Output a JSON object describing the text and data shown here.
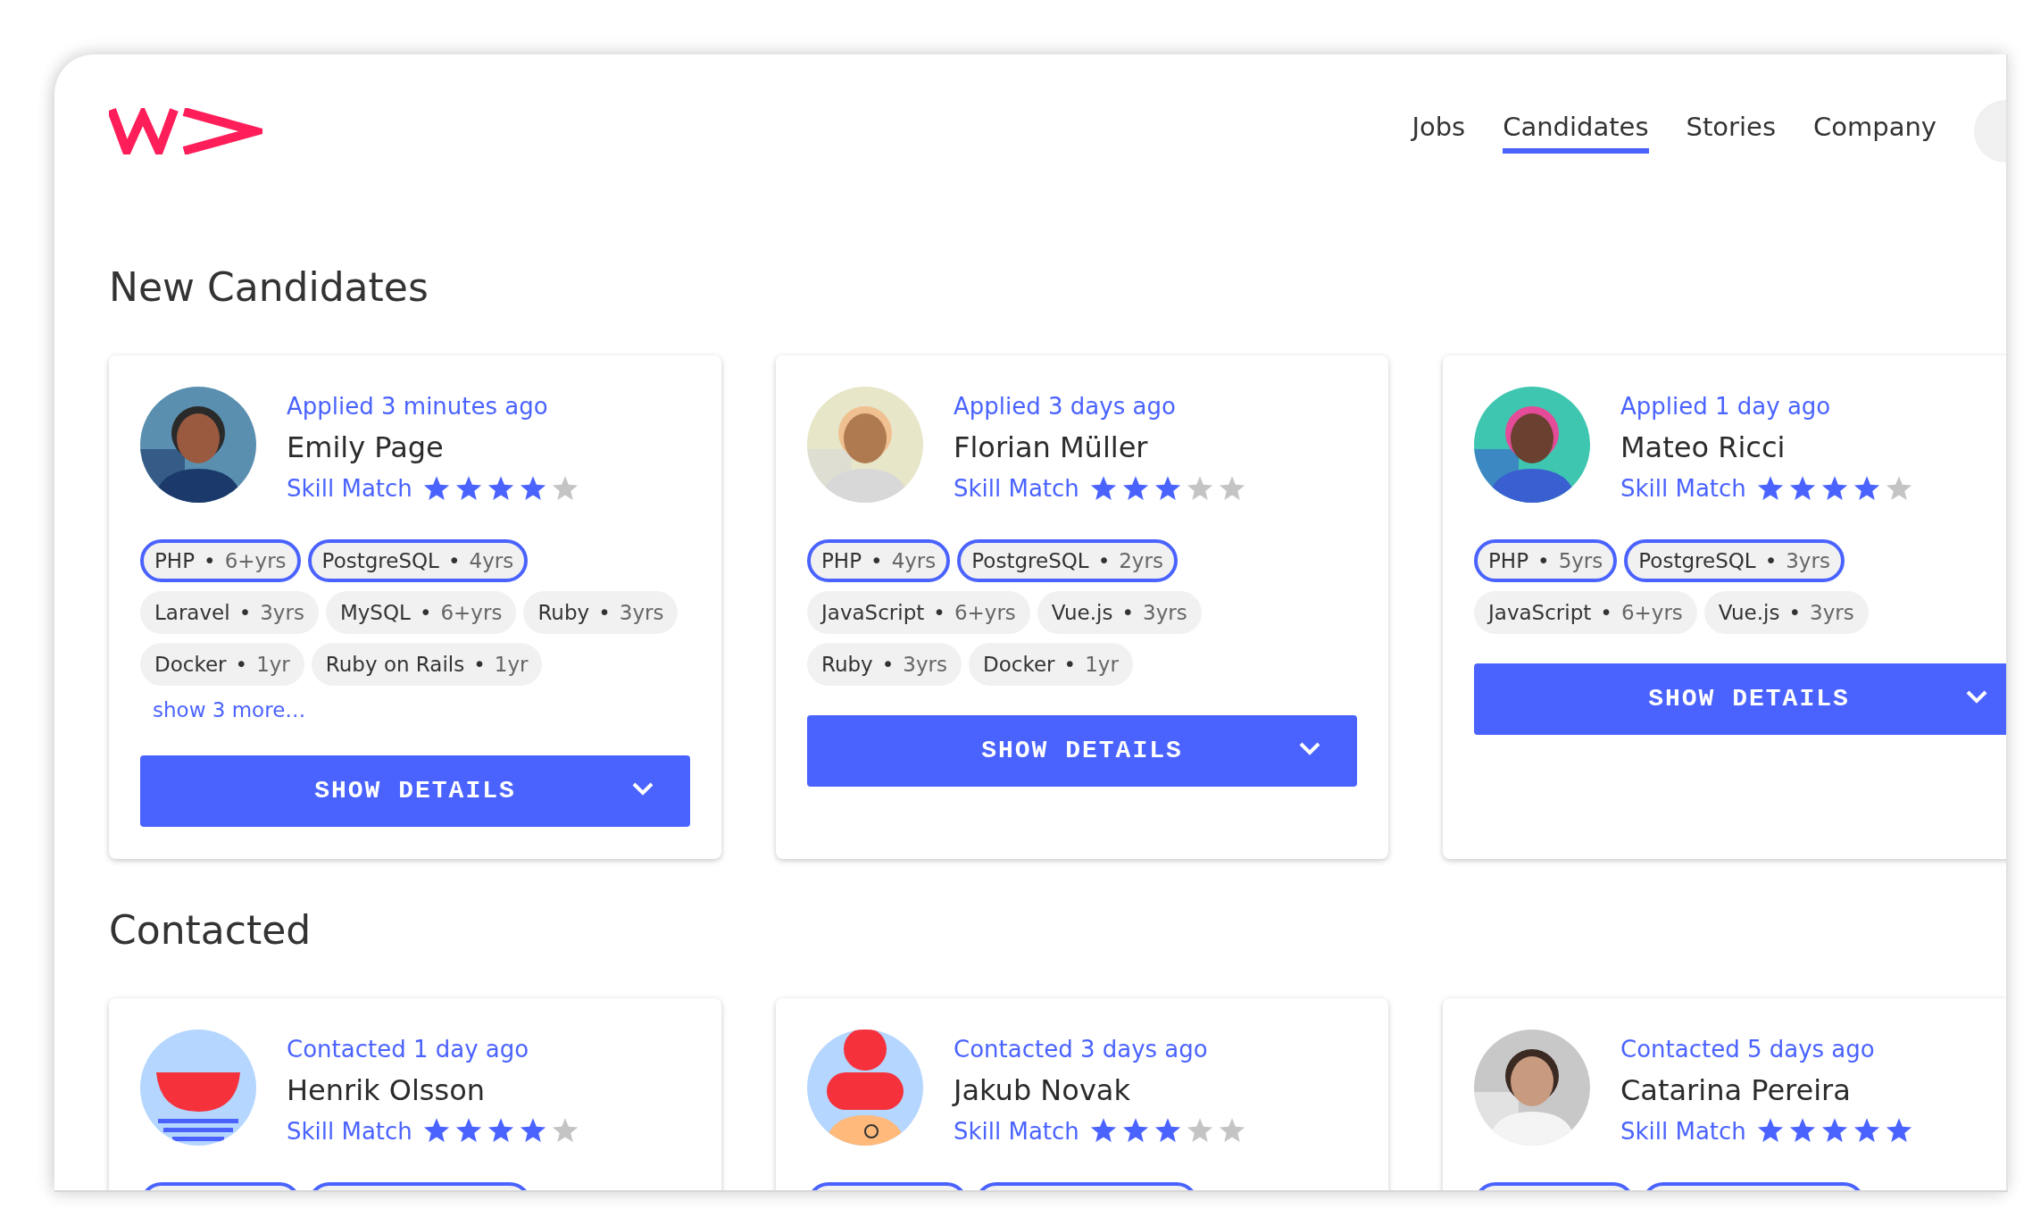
{
  "nav": [
    {
      "label": "Jobs",
      "selected": false
    },
    {
      "label": "Candidates",
      "selected": true
    },
    {
      "label": "Stories",
      "selected": false
    },
    {
      "label": "Company",
      "selected": false
    }
  ],
  "sections": [
    {
      "title": "New Candidates",
      "candidates": [
        {
          "status": "Applied 3 minutes ago",
          "name": "Emily Page",
          "match_label": "Skill Match",
          "stars": 4,
          "skills": [
            {
              "name": "PHP",
              "sep": "•",
              "years": "6+yrs",
              "highlighted": true
            },
            {
              "name": "PostgreSQL",
              "sep": "•",
              "years": "4yrs",
              "highlighted": true
            },
            {
              "name": "Laravel",
              "sep": "•",
              "years": "3yrs",
              "highlighted": false
            },
            {
              "name": "MySQL",
              "sep": "•",
              "years": "6+yrs",
              "highlighted": false
            },
            {
              "name": "Ruby",
              "sep": "•",
              "years": "3yrs",
              "highlighted": false
            },
            {
              "name": "Docker",
              "sep": "•",
              "years": "1yr",
              "highlighted": false
            },
            {
              "name": "Ruby on Rails",
              "sep": "•",
              "years": "1yr",
              "highlighted": false
            }
          ],
          "more": "show 3 more…",
          "button": "SHOW DETAILS"
        },
        {
          "status": "Applied 3 days ago",
          "name": "Florian Müller",
          "match_label": "Skill Match",
          "stars": 3,
          "skills": [
            {
              "name": "PHP",
              "sep": "•",
              "years": "4yrs",
              "highlighted": true
            },
            {
              "name": "PostgreSQL",
              "sep": "•",
              "years": "2yrs",
              "highlighted": true
            },
            {
              "name": "JavaScript",
              "sep": "•",
              "years": "6+yrs",
              "highlighted": false
            },
            {
              "name": "Vue.js",
              "sep": "•",
              "years": "3yrs",
              "highlighted": false
            },
            {
              "name": "Ruby",
              "sep": "•",
              "years": "3yrs",
              "highlighted": false
            },
            {
              "name": "Docker",
              "sep": "•",
              "years": "1yr",
              "highlighted": false
            }
          ],
          "button": "SHOW DETAILS"
        },
        {
          "status": "Applied 1 day ago",
          "name": "Mateo Ricci",
          "match_label": "Skill Match",
          "stars": 4,
          "skills": [
            {
              "name": "PHP",
              "sep": "•",
              "years": "5yrs",
              "highlighted": true
            },
            {
              "name": "PostgreSQL",
              "sep": "•",
              "years": "3yrs",
              "highlighted": true
            },
            {
              "name": "JavaScript",
              "sep": "•",
              "years": "6+yrs",
              "highlighted": false
            },
            {
              "name": "Vue.js",
              "sep": "•",
              "years": "3yrs",
              "highlighted": false
            }
          ],
          "button": "SHOW DETAILS"
        }
      ]
    },
    {
      "title": "Contacted",
      "candidates": [
        {
          "status": "Contacted 1 day ago",
          "name": "Henrik Olsson",
          "match_label": "Skill Match",
          "stars": 4,
          "skills": [
            {
              "highlighted": true
            },
            {
              "highlighted": true
            }
          ]
        },
        {
          "status": "Contacted 3 days ago",
          "name": "Jakub Novak",
          "match_label": "Skill Match",
          "stars": 3,
          "skills": [
            {
              "highlighted": true
            },
            {
              "highlighted": true
            }
          ]
        },
        {
          "status": "Contacted 5 days ago",
          "name": "Catarina Pereira",
          "match_label": "Skill Match",
          "stars": 5,
          "skills": [
            {
              "highlighted": true
            },
            {
              "highlighted": true
            }
          ]
        }
      ]
    }
  ]
}
